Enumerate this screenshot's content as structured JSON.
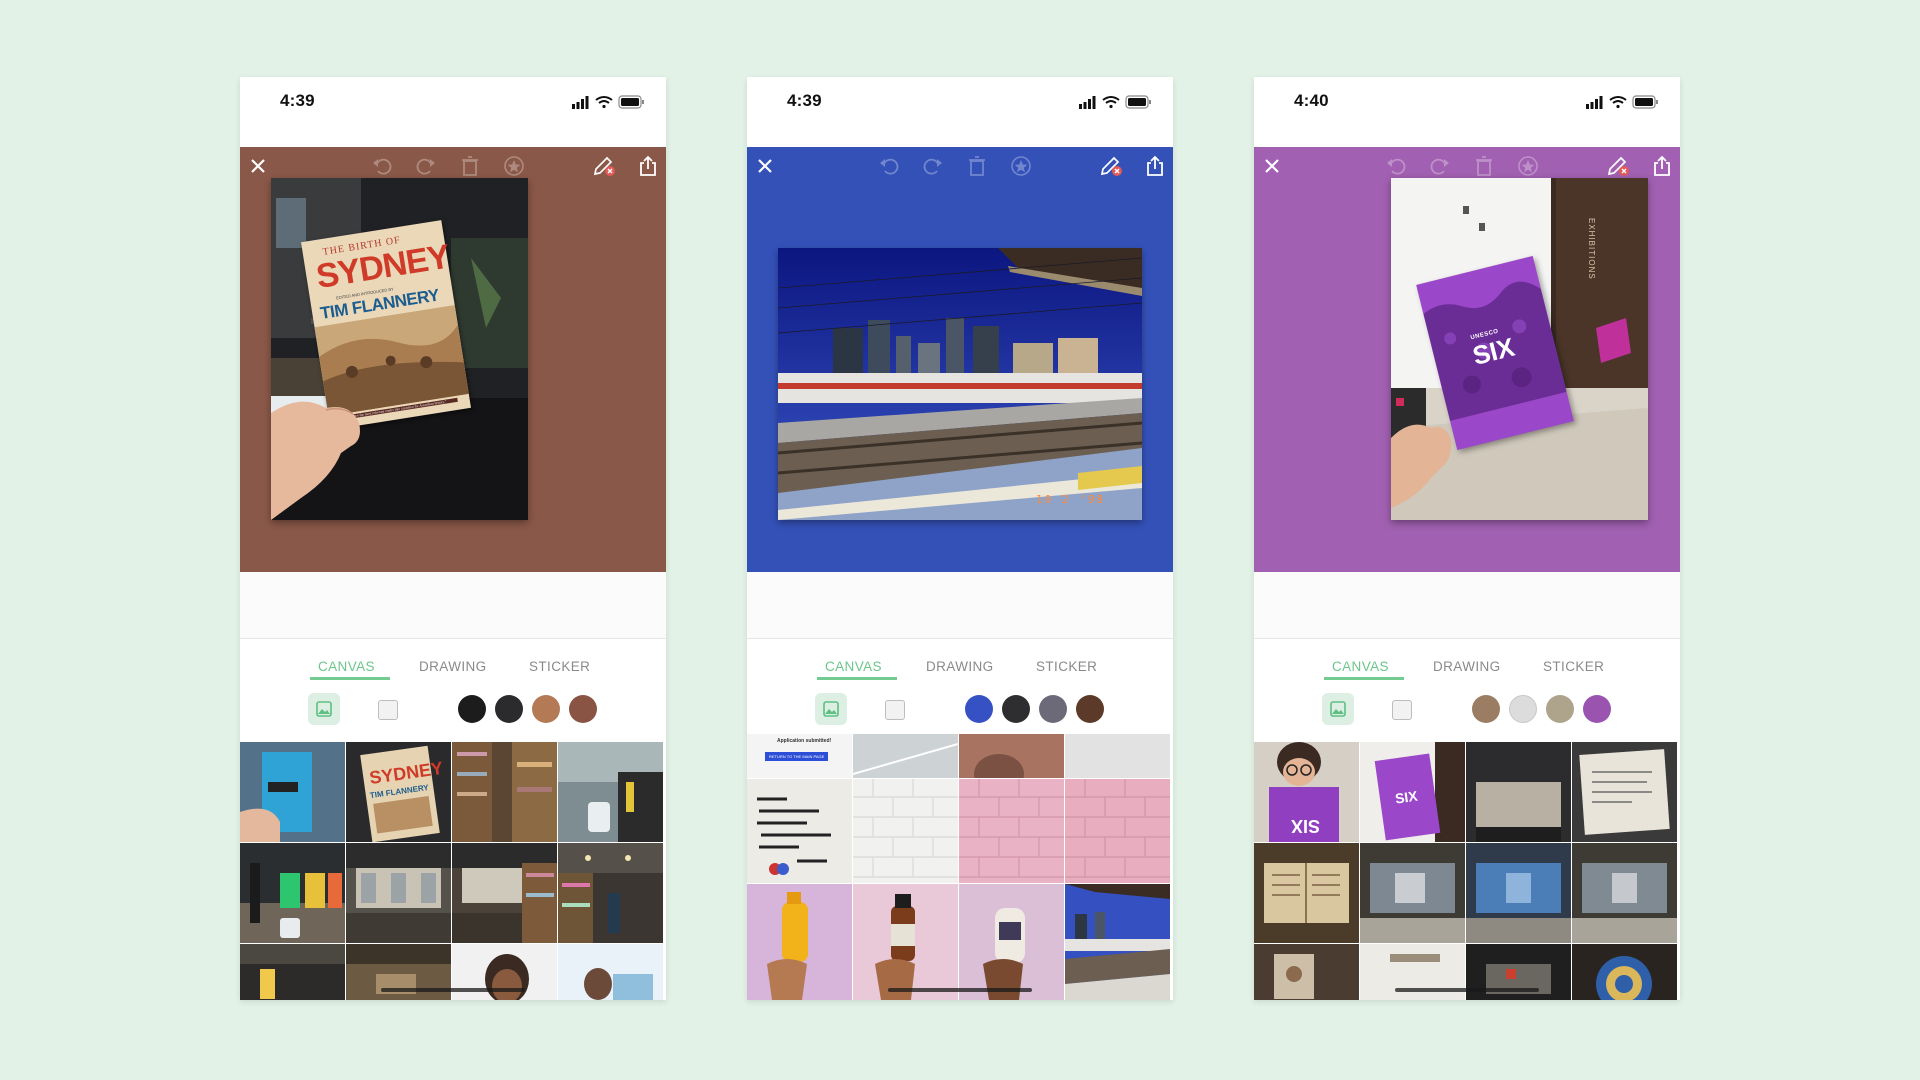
{
  "tabs": [
    "CANVAS",
    "DRAWING",
    "STICKER"
  ],
  "screens": [
    {
      "time": "4:39",
      "canvas_color": "#8a5848",
      "swatches": [
        "#1c1c1c",
        "#2b2b2d",
        "#b47a55",
        "#8a5444"
      ],
      "photo": {
        "subject": "book held in hand",
        "title_small": "THE BIRTH OF",
        "title_big": "SYDNEY",
        "subtitle": "EDITED AND INTRODUCED BY",
        "author": "TIM FLANNERY",
        "blurb": "\"Will seduce the most reluctant reader into a passion for Australian history.\""
      }
    },
    {
      "time": "4:39",
      "canvas_color": "#3451b8",
      "swatches": [
        "#3651c4",
        "#2e2e30",
        "#6c6a78",
        "#5c3a2a"
      ],
      "photo": {
        "subject": "train station platform with city skyline",
        "date_stamp": "10 2 '98"
      },
      "grid_text": {
        "submitted": "Application submitted!",
        "return_button": "RETURN TO THE MAIN PAGE"
      }
    },
    {
      "time": "4:40",
      "canvas_color": "#a160b1",
      "swatches": [
        "#9a7d62",
        "#dcdcdc",
        "#aea48c",
        "#9a54b0"
      ],
      "photo": {
        "subject": "purple brochure held in hand",
        "brochure_small": "UNESCO",
        "brochure_big": "SIX",
        "wall_text": "EXHIBITIONS"
      }
    }
  ]
}
